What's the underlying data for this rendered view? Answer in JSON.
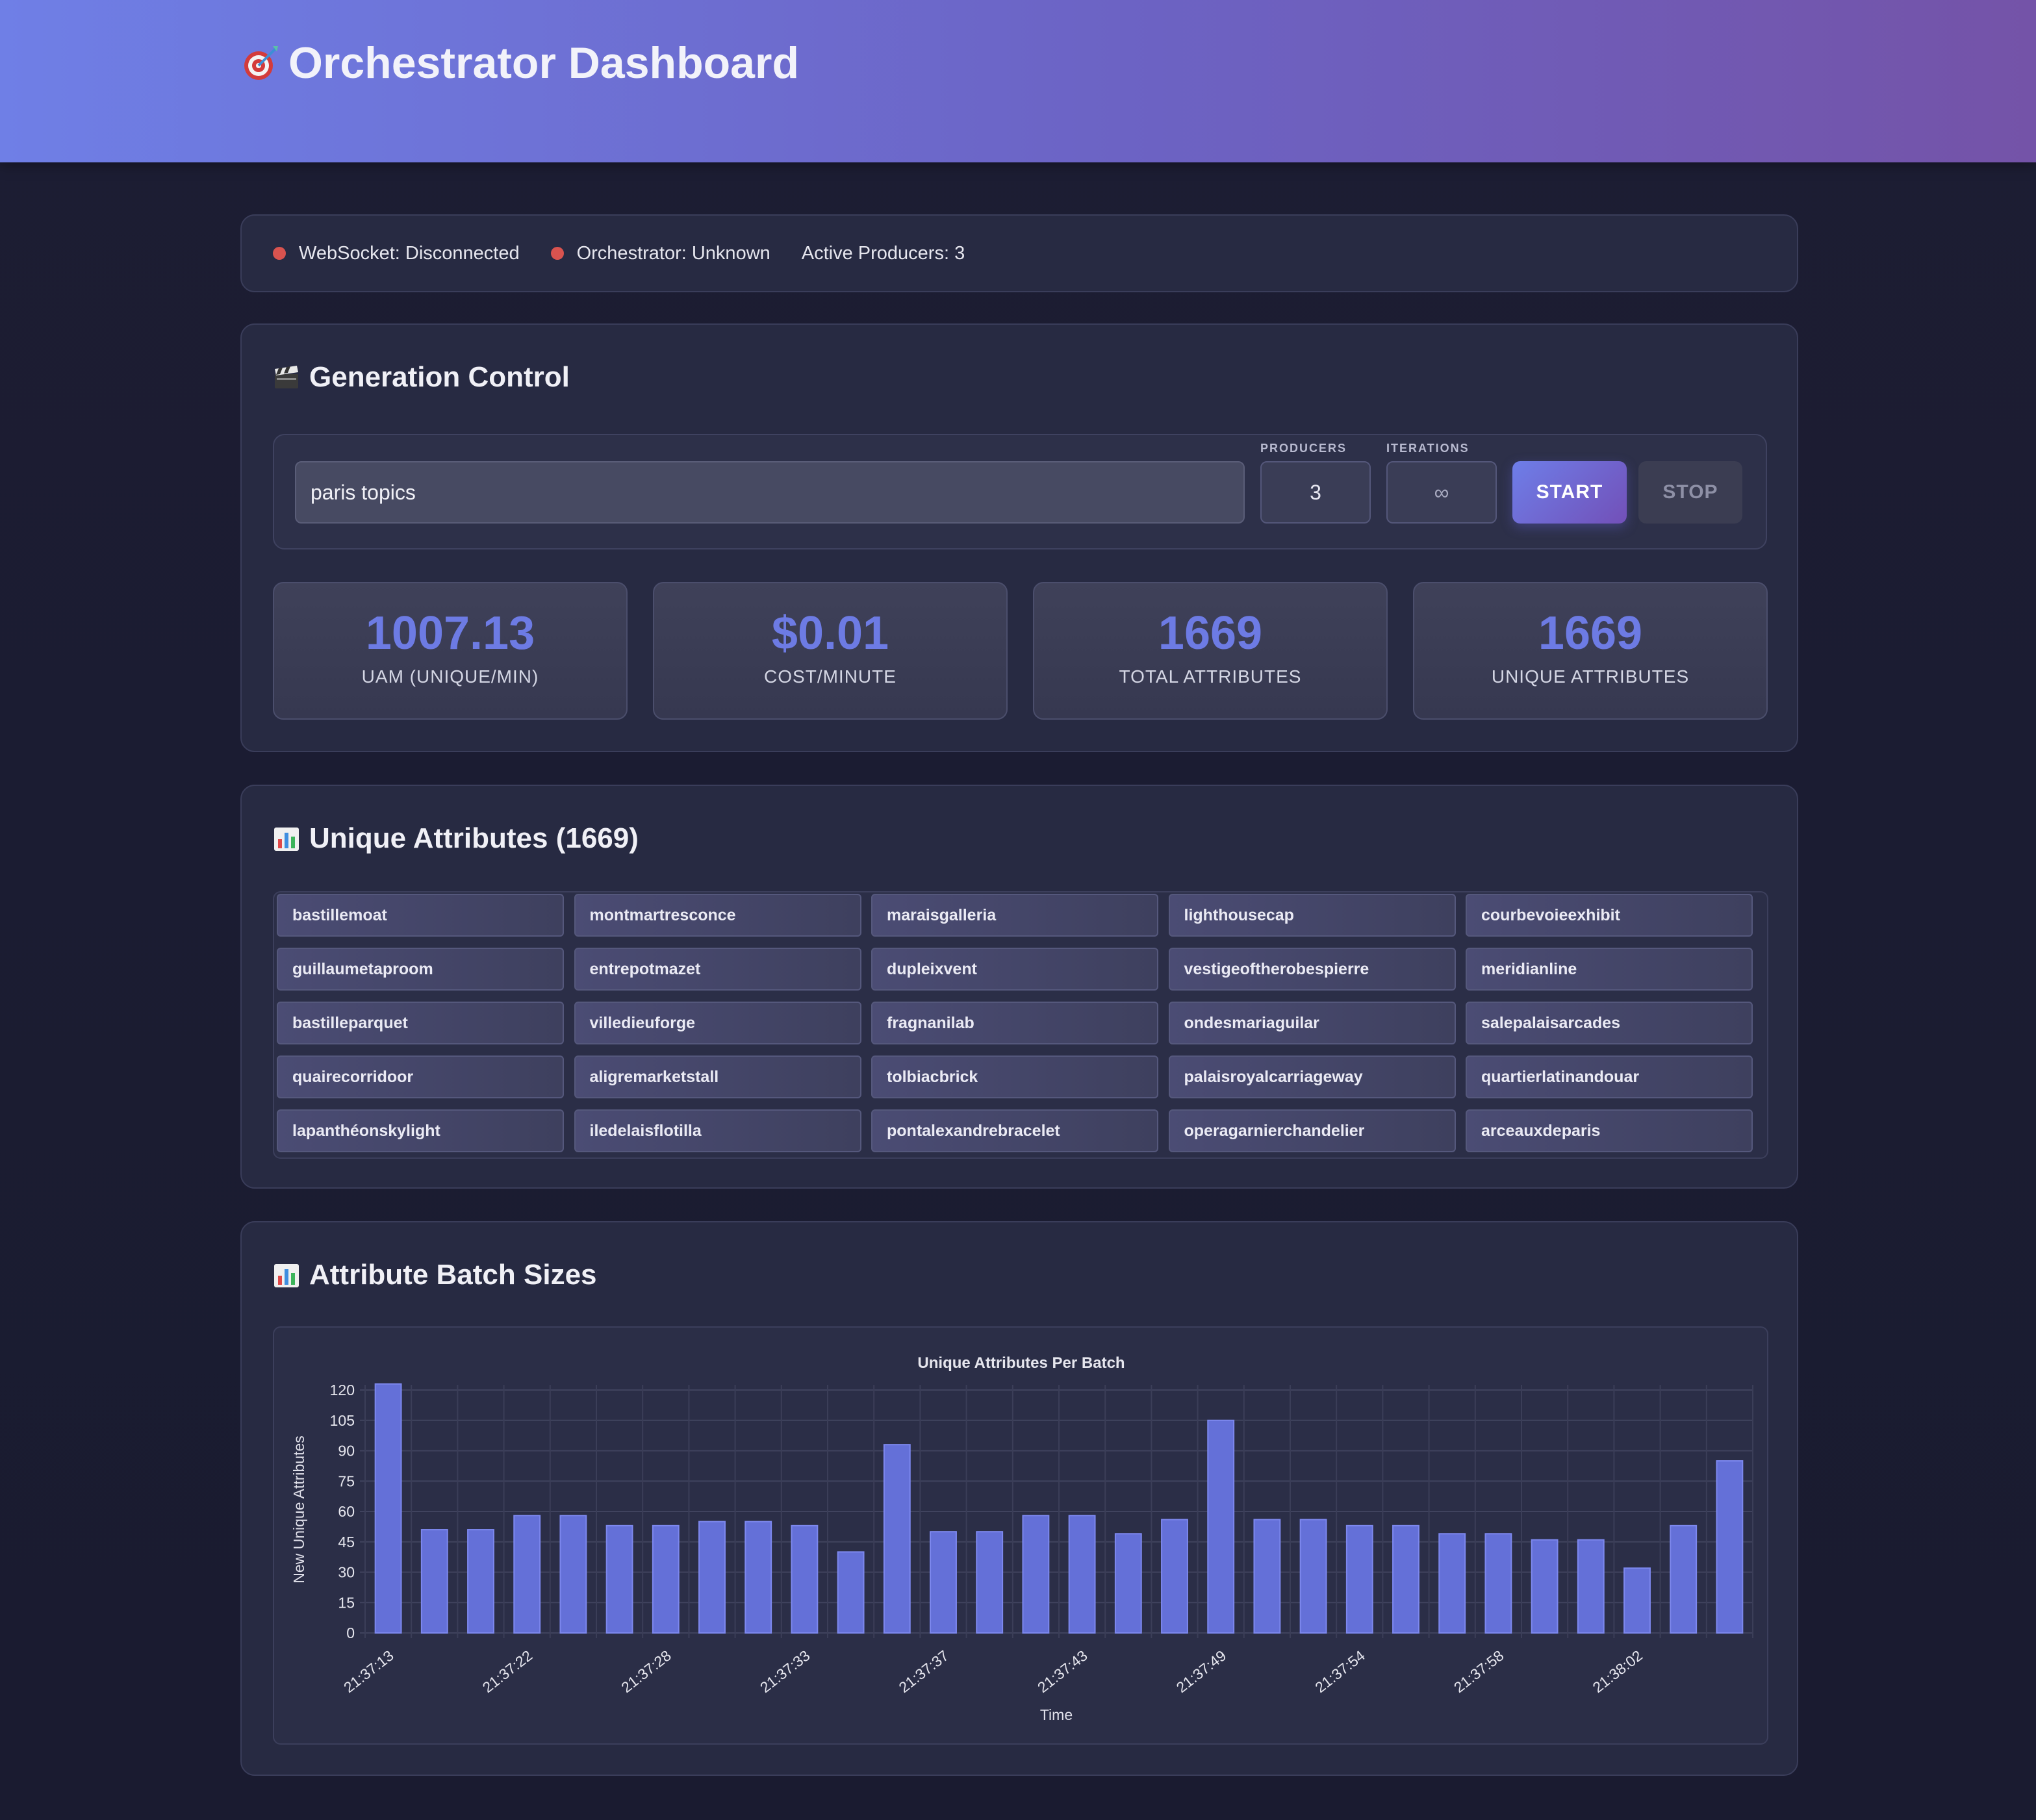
{
  "header": {
    "title": "Orchestrator Dashboard",
    "icon": "dart-icon"
  },
  "status": {
    "websocket": "WebSocket: Disconnected",
    "orchestrator": "Orchestrator: Unknown",
    "producers": "Active Producers: 3",
    "indicator_color": "#d9534f"
  },
  "control": {
    "title": "Generation Control",
    "icon": "clapper-board-icon",
    "topic_value": "paris topics",
    "producers_label": "PRODUCERS",
    "producers_value": "3",
    "iterations_label": "ITERATIONS",
    "iterations_value": "∞",
    "start_label": "START",
    "stop_label": "STOP"
  },
  "metrics": [
    {
      "value": "1007.13",
      "label": "UAM (UNIQUE/MIN)"
    },
    {
      "value": "$0.01",
      "label": "COST/MINUTE"
    },
    {
      "value": "1669",
      "label": "TOTAL ATTRIBUTES"
    },
    {
      "value": "1669",
      "label": "UNIQUE ATTRIBUTES"
    }
  ],
  "attributes": {
    "title": "Unique Attributes (1669)",
    "icon": "bar-chart-icon",
    "items": [
      "bastillemoat",
      "montmartresconce",
      "maraisgalleria",
      "lighthousecap",
      "courbevoieexhibit",
      "guillaumetaproom",
      "entrepotmazet",
      "dupleixvent",
      "vestigeoftherobespierre",
      "meridianline",
      "bastilleparquet",
      "villedieuforge",
      "fragnanilab",
      "ondesmariaguilar",
      "salepalaisarcades",
      "quairecorridoor",
      "aligremarketstall",
      "tolbiacbrick",
      "palaisroyalcarriageway",
      "quartierlatinandouar",
      "lapanthéonskylight",
      "iledelaisflotilla",
      "pontalexandrebracelet",
      "operagarnierchandelier",
      "arceauxdeparis"
    ]
  },
  "batch": {
    "title": "Attribute Batch Sizes",
    "icon": "bar-chart-icon"
  },
  "chart_data": {
    "type": "bar",
    "title": "Unique Attributes Per Batch",
    "xlabel": "Time",
    "ylabel": "New Unique Attributes",
    "ylim": [
      0,
      120
    ],
    "yticks": [
      0,
      15,
      30,
      45,
      60,
      75,
      90,
      105,
      120
    ],
    "x_tick_labels": [
      "21:37:13",
      "21:37:22",
      "21:37:28",
      "21:37:33",
      "21:37:37",
      "21:37:43",
      "21:37:49",
      "21:37:54",
      "21:37:58",
      "21:38:02"
    ],
    "values": [
      123,
      51,
      51,
      58,
      58,
      53,
      53,
      55,
      55,
      53,
      40,
      93,
      50,
      50,
      58,
      58,
      49,
      56,
      105,
      56,
      56,
      53,
      53,
      49,
      49,
      46,
      46,
      32,
      53,
      85
    ],
    "bar_color": "#6470d8",
    "grid": true
  }
}
